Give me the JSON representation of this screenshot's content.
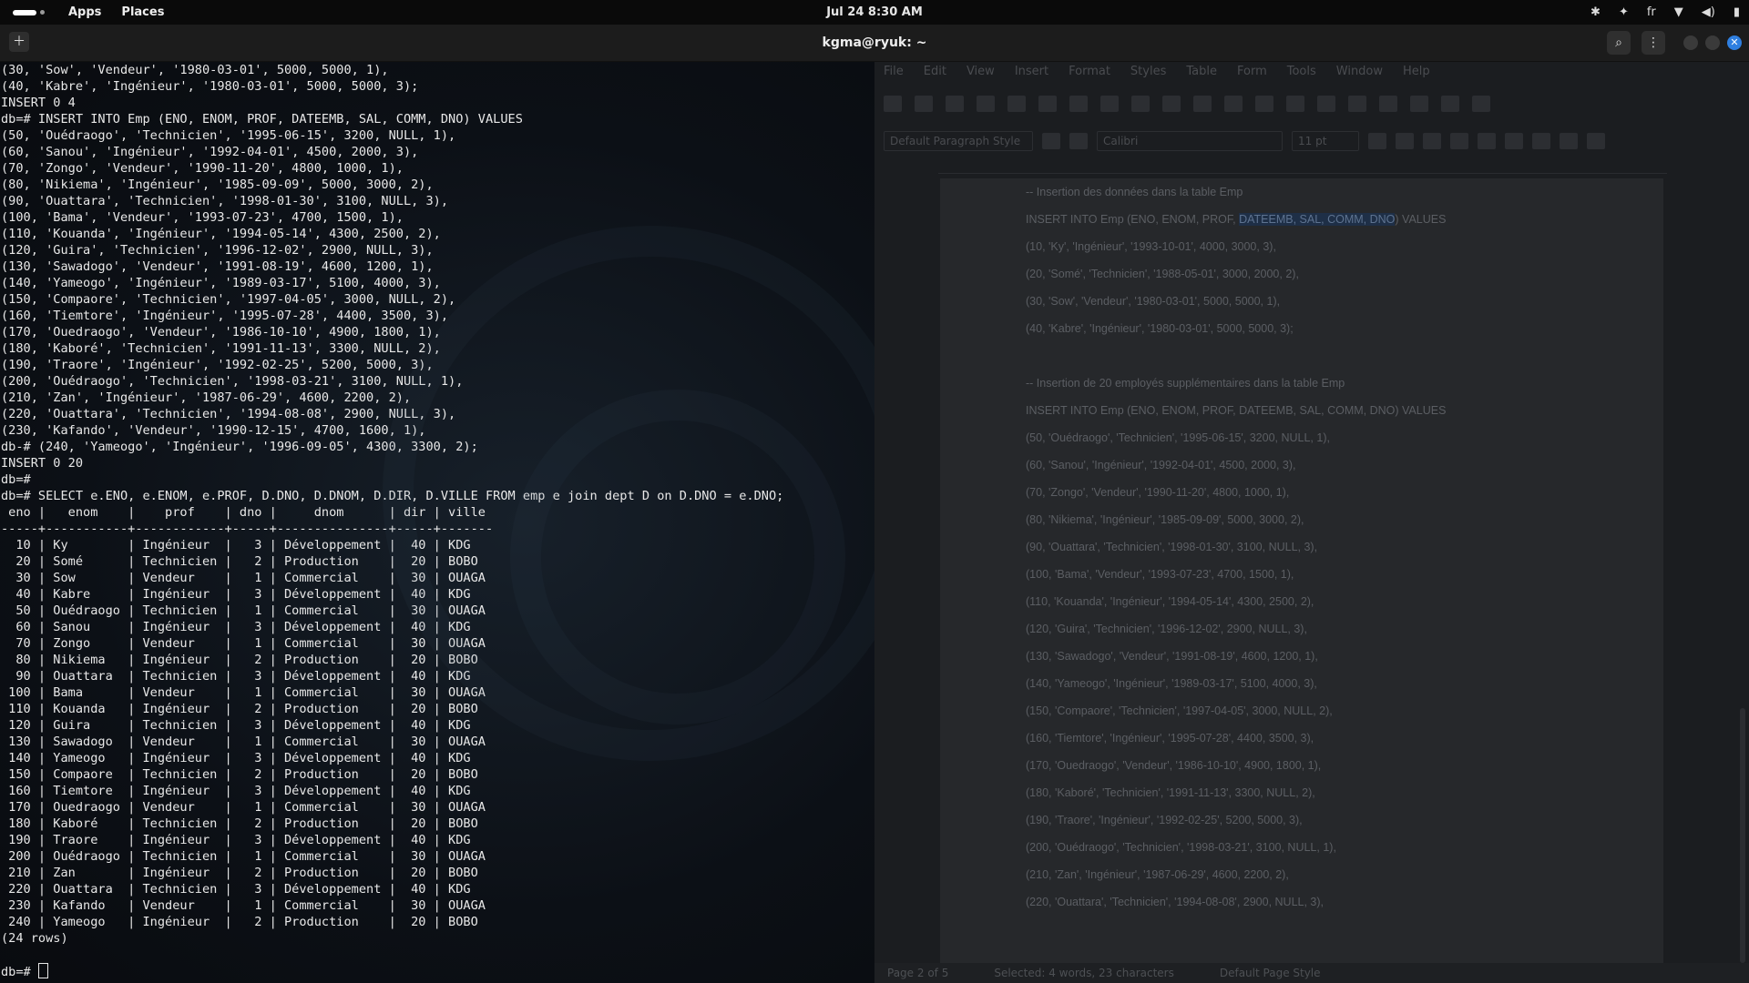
{
  "topbar": {
    "apps_label": "Apps",
    "places_label": "Places",
    "clock": "Jul 24  8:30 AM",
    "keyboard_layout": "fr"
  },
  "terminal": {
    "title": "kgma@ryuk: ~",
    "lines": [
      "(30, 'Sow', 'Vendeur', '1980-03-01', 5000, 5000, 1),",
      "(40, 'Kabre', 'Ingénieur', '1980-03-01', 5000, 5000, 3);",
      "INSERT 0 4",
      "db=# INSERT INTO Emp (ENO, ENOM, PROF, DATEEMB, SAL, COMM, DNO) VALUES",
      "(50, 'Ouédraogo', 'Technicien', '1995-06-15', 3200, NULL, 1),",
      "(60, 'Sanou', 'Ingénieur', '1992-04-01', 4500, 2000, 3),",
      "(70, 'Zongo', 'Vendeur', '1990-11-20', 4800, 1000, 1),",
      "(80, 'Nikiema', 'Ingénieur', '1985-09-09', 5000, 3000, 2),",
      "(90, 'Ouattara', 'Technicien', '1998-01-30', 3100, NULL, 3),",
      "(100, 'Bama', 'Vendeur', '1993-07-23', 4700, 1500, 1),",
      "(110, 'Kouanda', 'Ingénieur', '1994-05-14', 4300, 2500, 2),",
      "(120, 'Guira', 'Technicien', '1996-12-02', 2900, NULL, 3),",
      "(130, 'Sawadogo', 'Vendeur', '1991-08-19', 4600, 1200, 1),",
      "(140, 'Yameogo', 'Ingénieur', '1989-03-17', 5100, 4000, 3),",
      "(150, 'Compaore', 'Technicien', '1997-04-05', 3000, NULL, 2),",
      "(160, 'Tiemtore', 'Ingénieur', '1995-07-28', 4400, 3500, 3),",
      "(170, 'Ouedraogo', 'Vendeur', '1986-10-10', 4900, 1800, 1),",
      "(180, 'Kaboré', 'Technicien', '1991-11-13', 3300, NULL, 2),",
      "(190, 'Traore', 'Ingénieur', '1992-02-25', 5200, 5000, 3),",
      "(200, 'Ouédraogo', 'Technicien', '1998-03-21', 3100, NULL, 1),",
      "(210, 'Zan', 'Ingénieur', '1987-06-29', 4600, 2200, 2),",
      "(220, 'Ouattara', 'Technicien', '1994-08-08', 2900, NULL, 3),",
      "(230, 'Kafando', 'Vendeur', '1990-12-15', 4700, 1600, 1),",
      "db-# (240, 'Yameogo', 'Ingénieur', '1996-09-05', 4300, 3300, 2);",
      "INSERT 0 20",
      "db=#",
      "db=# SELECT e.ENO, e.ENOM, e.PROF, D.DNO, D.DNOM, D.DIR, D.VILLE FROM emp e join dept D on D.DNO = e.DNO;",
      " eno |   enom    |    prof    | dno |     dnom      | dir | ville",
      "-----+-----------+------------+-----+---------------+-----+-------",
      "  10 | Ky        | Ingénieur  |   3 | Développement |  40 | KDG",
      "  20 | Somé      | Technicien |   2 | Production    |  20 | BOBO",
      "  30 | Sow       | Vendeur    |   1 | Commercial    |  30 | OUAGA",
      "  40 | Kabre     | Ingénieur  |   3 | Développement |  40 | KDG",
      "  50 | Ouédraogo | Technicien |   1 | Commercial    |  30 | OUAGA",
      "  60 | Sanou     | Ingénieur  |   3 | Développement |  40 | KDG",
      "  70 | Zongo     | Vendeur    |   1 | Commercial    |  30 | OUAGA",
      "  80 | Nikiema   | Ingénieur  |   2 | Production    |  20 | BOBO",
      "  90 | Ouattara  | Technicien |   3 | Développement |  40 | KDG",
      " 100 | Bama      | Vendeur    |   1 | Commercial    |  30 | OUAGA",
      " 110 | Kouanda   | Ingénieur  |   2 | Production    |  20 | BOBO",
      " 120 | Guira     | Technicien |   3 | Développement |  40 | KDG",
      " 130 | Sawadogo  | Vendeur    |   1 | Commercial    |  30 | OUAGA",
      " 140 | Yameogo   | Ingénieur  |   3 | Développement |  40 | KDG",
      " 150 | Compaore  | Technicien |   2 | Production    |  20 | BOBO",
      " 160 | Tiemtore  | Ingénieur  |   3 | Développement |  40 | KDG",
      " 170 | Ouedraogo | Vendeur    |   1 | Commercial    |  30 | OUAGA",
      " 180 | Kaboré    | Technicien |   2 | Production    |  20 | BOBO",
      " 190 | Traore    | Ingénieur  |   3 | Développement |  40 | KDG",
      " 200 | Ouédraogo | Technicien |   1 | Commercial    |  30 | OUAGA",
      " 210 | Zan       | Ingénieur  |   2 | Production    |  20 | BOBO",
      " 220 | Ouattara  | Technicien |   3 | Développement |  40 | KDG",
      " 230 | Kafando   | Vendeur    |   1 | Commercial    |  30 | OUAGA",
      " 240 | Yameogo   | Ingénieur  |   2 | Production    |  20 | BOBO",
      "(24 rows)",
      ""
    ],
    "prompt": "db=# "
  },
  "writer": {
    "menu": [
      "File",
      "Edit",
      "View",
      "Insert",
      "Format",
      "Styles",
      "Table",
      "Form",
      "Tools",
      "Window",
      "Help"
    ],
    "paragraph_style": "Default Paragraph Style",
    "font_name": "Calibri",
    "font_size": "11 pt",
    "doc_lines": [
      "-- Insertion des données dans la table Emp",
      "INSERT INTO Emp (ENO, ENOM, PROF, DATEEMB, SAL, COMM, DNO) VALUES",
      "(10, 'Ky', 'Ingénieur', '1993-10-01', 4000, 3000, 3),",
      "(20, 'Somé', 'Technicien', '1988-05-01', 3000, 2000, 2),",
      "(30, 'Sow', 'Vendeur', '1980-03-01', 5000, 5000, 1),",
      "(40, 'Kabre', 'Ingénieur', '1980-03-01', 5000, 5000, 3);",
      "",
      "-- Insertion de 20 employés supplémentaires dans la table Emp",
      "INSERT INTO Emp (ENO, ENOM, PROF, DATEEMB, SAL, COMM, DNO) VALUES",
      "(50, 'Ouédraogo', 'Technicien', '1995-06-15', 3200, NULL, 1),",
      "(60, 'Sanou', 'Ingénieur', '1992-04-01', 4500, 2000, 3),",
      "(70, 'Zongo', 'Vendeur', '1990-11-20', 4800, 1000, 1),",
      "(80, 'Nikiema', 'Ingénieur', '1985-09-09', 5000, 3000, 2),",
      "(90, 'Ouattara', 'Technicien', '1998-01-30', 3100, NULL, 3),",
      "(100, 'Bama', 'Vendeur', '1993-07-23', 4700, 1500, 1),",
      "(110, 'Kouanda', 'Ingénieur', '1994-05-14', 4300, 2500, 2),",
      "(120, 'Guira', 'Technicien', '1996-12-02', 2900, NULL, 3),",
      "(130, 'Sawadogo', 'Vendeur', '1991-08-19', 4600, 1200, 1),",
      "(140, 'Yameogo', 'Ingénieur', '1989-03-17', 5100, 4000, 3),",
      "(150, 'Compaore', 'Technicien', '1997-04-05', 3000, NULL, 2),",
      "(160, 'Tiemtore', 'Ingénieur', '1995-07-28', 4400, 3500, 3),",
      "(170, 'Ouedraogo', 'Vendeur', '1986-10-10', 4900, 1800, 1),",
      "(180, 'Kaboré', 'Technicien', '1991-11-13', 3300, NULL, 2),",
      "(190, 'Traore', 'Ingénieur', '1992-02-25', 5200, 5000, 3),",
      "(200, 'Ouédraogo', 'Technicien', '1998-03-21', 3100, NULL, 1),",
      "(210, 'Zan', 'Ingénieur', '1987-06-29', 4600, 2200, 2),",
      "(220, 'Ouattara', 'Technicien', '1994-08-08', 2900, NULL, 3),"
    ],
    "status_page": "Page 2 of 5",
    "status_selection": "Selected: 4 words, 23 characters",
    "status_style": "Default Page Style"
  },
  "colors": {
    "terminal_text": "#e8e8e8",
    "close_button": "#2f7fe0"
  }
}
